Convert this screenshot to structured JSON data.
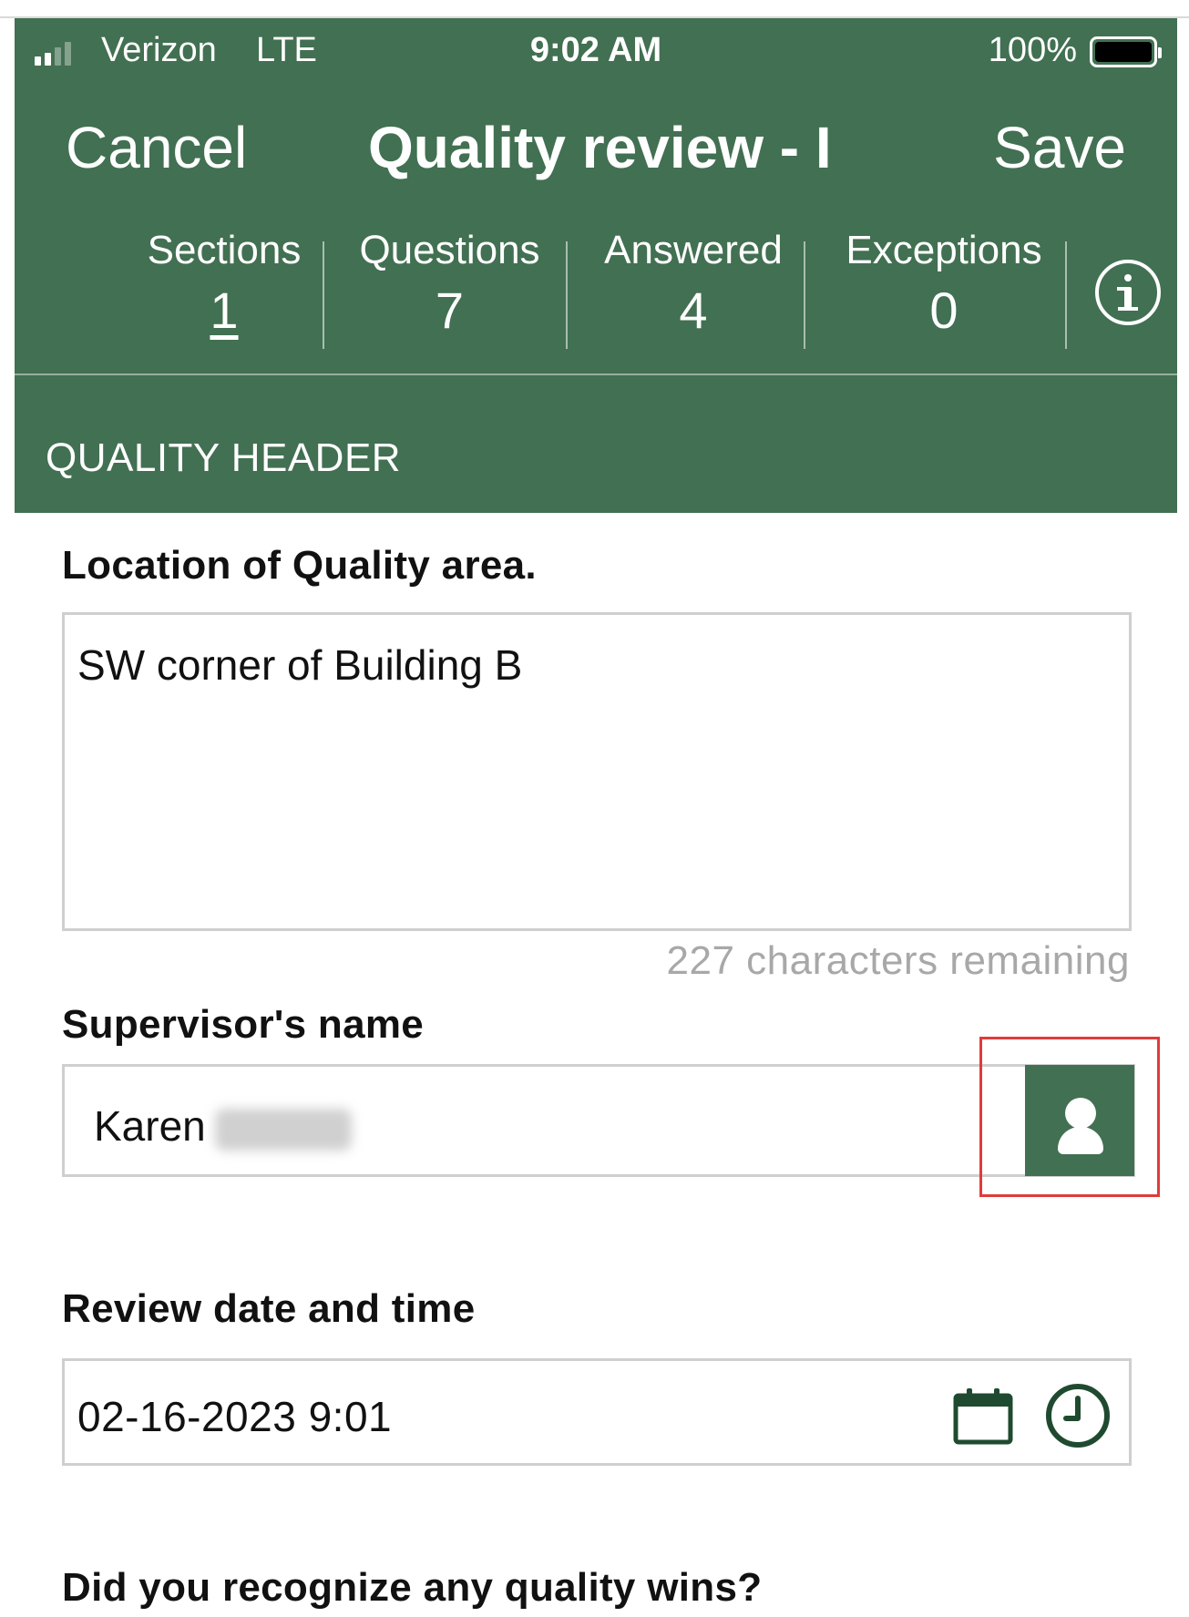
{
  "status_bar": {
    "carrier": "Verizon",
    "network": "LTE",
    "time": "9:02 AM",
    "battery": "100%",
    "signal_bars_filled": 2,
    "signal_bars_total": 4
  },
  "nav": {
    "cancel_label": "Cancel",
    "title": "Quality review - I",
    "save_label": "Save"
  },
  "stats": [
    {
      "label": "Sections",
      "value": "1"
    },
    {
      "label": "Questions",
      "value": "7"
    },
    {
      "label": "Answered",
      "value": "4"
    },
    {
      "label": "Exceptions",
      "value": "0"
    }
  ],
  "section": {
    "title": "QUALITY HEADER"
  },
  "fields": {
    "location": {
      "label": "Location of Quality area.",
      "value": "SW corner of Building B",
      "remaining": "227 characters remaining"
    },
    "supervisor": {
      "label": "Supervisor's name",
      "value": "Karen"
    },
    "review_date": {
      "label": "Review date and time",
      "value": "02-16-2023 9:01"
    },
    "quality_wins": {
      "label": "Did you recognize any quality wins?"
    }
  },
  "icons": {
    "info": "info-icon",
    "person": "person-icon",
    "calendar": "calendar-icon",
    "clock": "clock-icon"
  },
  "colors": {
    "brand_green": "#427052",
    "highlight_red": "#e03b3b",
    "muted_text": "#a8a8a8"
  }
}
